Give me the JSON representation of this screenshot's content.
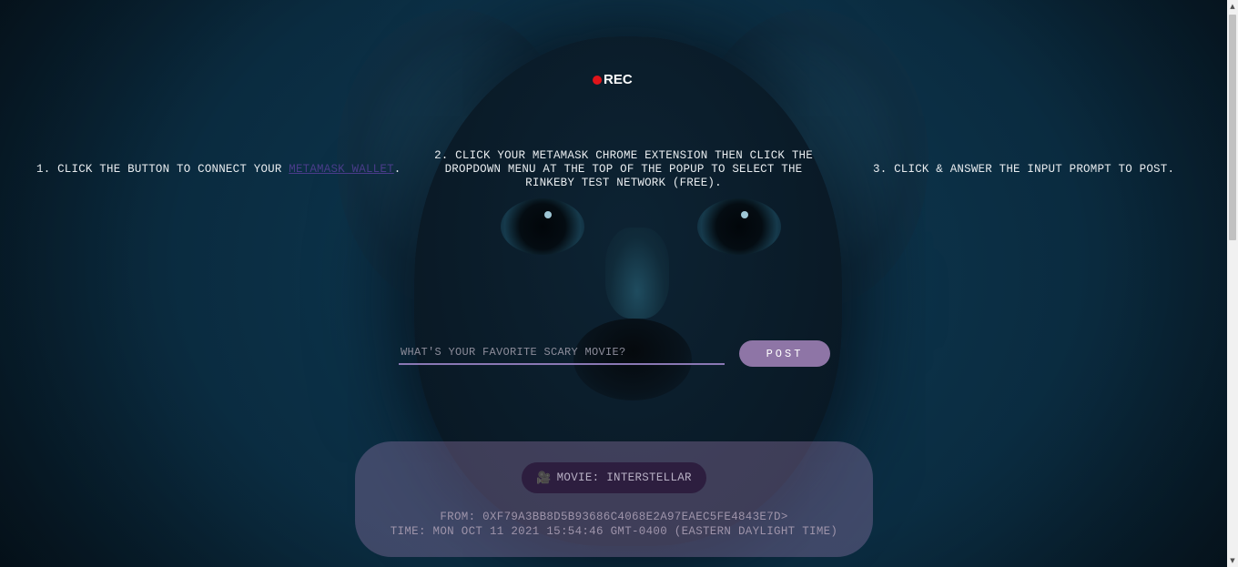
{
  "rec": {
    "label": "REC"
  },
  "steps": {
    "step1_prefix": "1. CLICK THE BUTTON TO CONNECT YOUR ",
    "step1_link": "METAMASK WALLET",
    "step1_suffix": ".",
    "step2": "2. CLICK YOUR METAMASK CHROME EXTENSION THEN CLICK THE DROPDOWN MENU AT THE TOP OF THE POPUP TO SELECT THE RINKEBY TEST NETWORK (FREE).",
    "step3": "3. CLICK & ANSWER THE INPUT PROMPT TO POST."
  },
  "form": {
    "placeholder": "WHAT'S YOUR FAVORITE SCARY MOVIE?",
    "value": "",
    "post_label": "POST"
  },
  "post": {
    "camera_icon": "🎥",
    "movie_label": "MOVIE: INTERSTELLAR",
    "from": "FROM: 0XF79A3BB8D5B93686C4068E2A97EAEC5FE4843E7D>",
    "time": "TIME: MON OCT 11 2021 15:54:46 GMT-0400 (EASTERN DAYLIGHT TIME)"
  },
  "scrollbar": {
    "up_icon": "▲",
    "down_icon": "▼"
  },
  "colors": {
    "accent": "#8e75a6",
    "rec_dot": "#e0141a",
    "link": "#4a3c8a",
    "background": "#0a2a3e"
  }
}
